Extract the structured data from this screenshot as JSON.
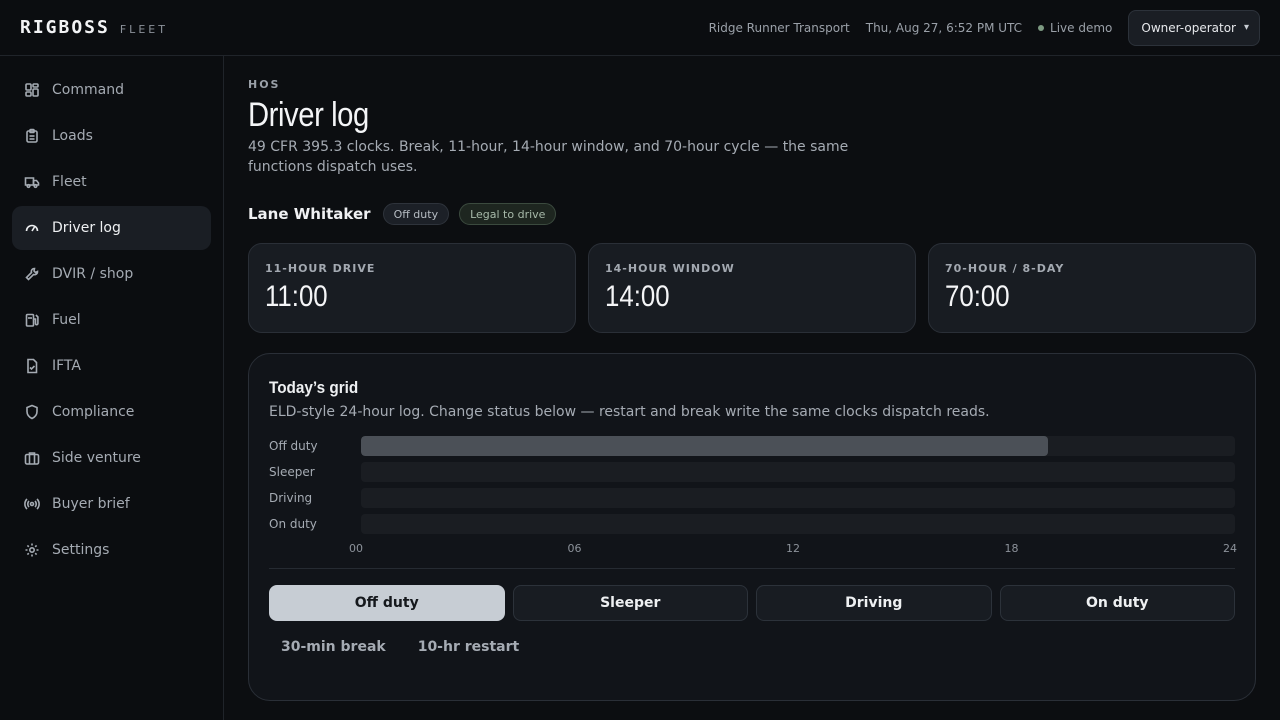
{
  "brand": {
    "name": "RIGBOSS",
    "sub": "FLEET"
  },
  "header": {
    "company": "Ridge Runner Transport",
    "datetime": "Thu, Aug 27, 6:52 PM UTC",
    "live_label": "Live demo",
    "role_select": "Owner-operator"
  },
  "sidebar": {
    "items": [
      {
        "label": "Command",
        "icon": "dashboard-icon"
      },
      {
        "label": "Loads",
        "icon": "clipboard-icon"
      },
      {
        "label": "Fleet",
        "icon": "truck-icon"
      },
      {
        "label": "Driver log",
        "icon": "gauge-icon",
        "active": true
      },
      {
        "label": "DVIR / shop",
        "icon": "wrench-icon"
      },
      {
        "label": "Fuel",
        "icon": "fuel-pump-icon"
      },
      {
        "label": "IFTA",
        "icon": "file-check-icon"
      },
      {
        "label": "Compliance",
        "icon": "shield-icon"
      },
      {
        "label": "Side venture",
        "icon": "briefcase-icon"
      },
      {
        "label": "Buyer brief",
        "icon": "broadcast-icon"
      },
      {
        "label": "Settings",
        "icon": "gear-icon"
      }
    ]
  },
  "page": {
    "eyebrow": "HOS",
    "title": "Driver log",
    "description": "49 CFR 395.3 clocks. Break, 11-hour, 14-hour window, and 70-hour cycle — the same functions dispatch uses."
  },
  "driver": {
    "name": "Lane Whitaker",
    "status_badge": "Off duty",
    "legal_badge": "Legal to drive"
  },
  "clocks": [
    {
      "label": "11-HOUR DRIVE",
      "value": "11:00"
    },
    {
      "label": "14-HOUR WINDOW",
      "value": "14:00"
    },
    {
      "label": "70-HOUR / 8-DAY",
      "value": "70:00"
    }
  ],
  "grid": {
    "title": "Today’s grid",
    "subtitle": "ELD-style 24-hour log. Change status below — restart and break write the same clocks dispatch reads.",
    "tracks": [
      {
        "label": "Off duty",
        "start_hour": 0,
        "end_hour": 18.87
      },
      {
        "label": "Sleeper",
        "start_hour": 0,
        "end_hour": 0
      },
      {
        "label": "Driving",
        "start_hour": 0,
        "end_hour": 0
      },
      {
        "label": "On duty",
        "start_hour": 0,
        "end_hour": 0
      }
    ],
    "ticks": [
      "00",
      "06",
      "12",
      "18",
      "24"
    ],
    "colors": {
      "fill": "#4b5057",
      "track": "#1a1d22"
    }
  },
  "status_buttons": [
    {
      "label": "Off duty",
      "selected": true
    },
    {
      "label": "Sleeper",
      "selected": false
    },
    {
      "label": "Driving",
      "selected": false
    },
    {
      "label": "On duty",
      "selected": false
    }
  ],
  "actions": {
    "break_label": "30-min break",
    "restart_label": "10-hr restart"
  }
}
